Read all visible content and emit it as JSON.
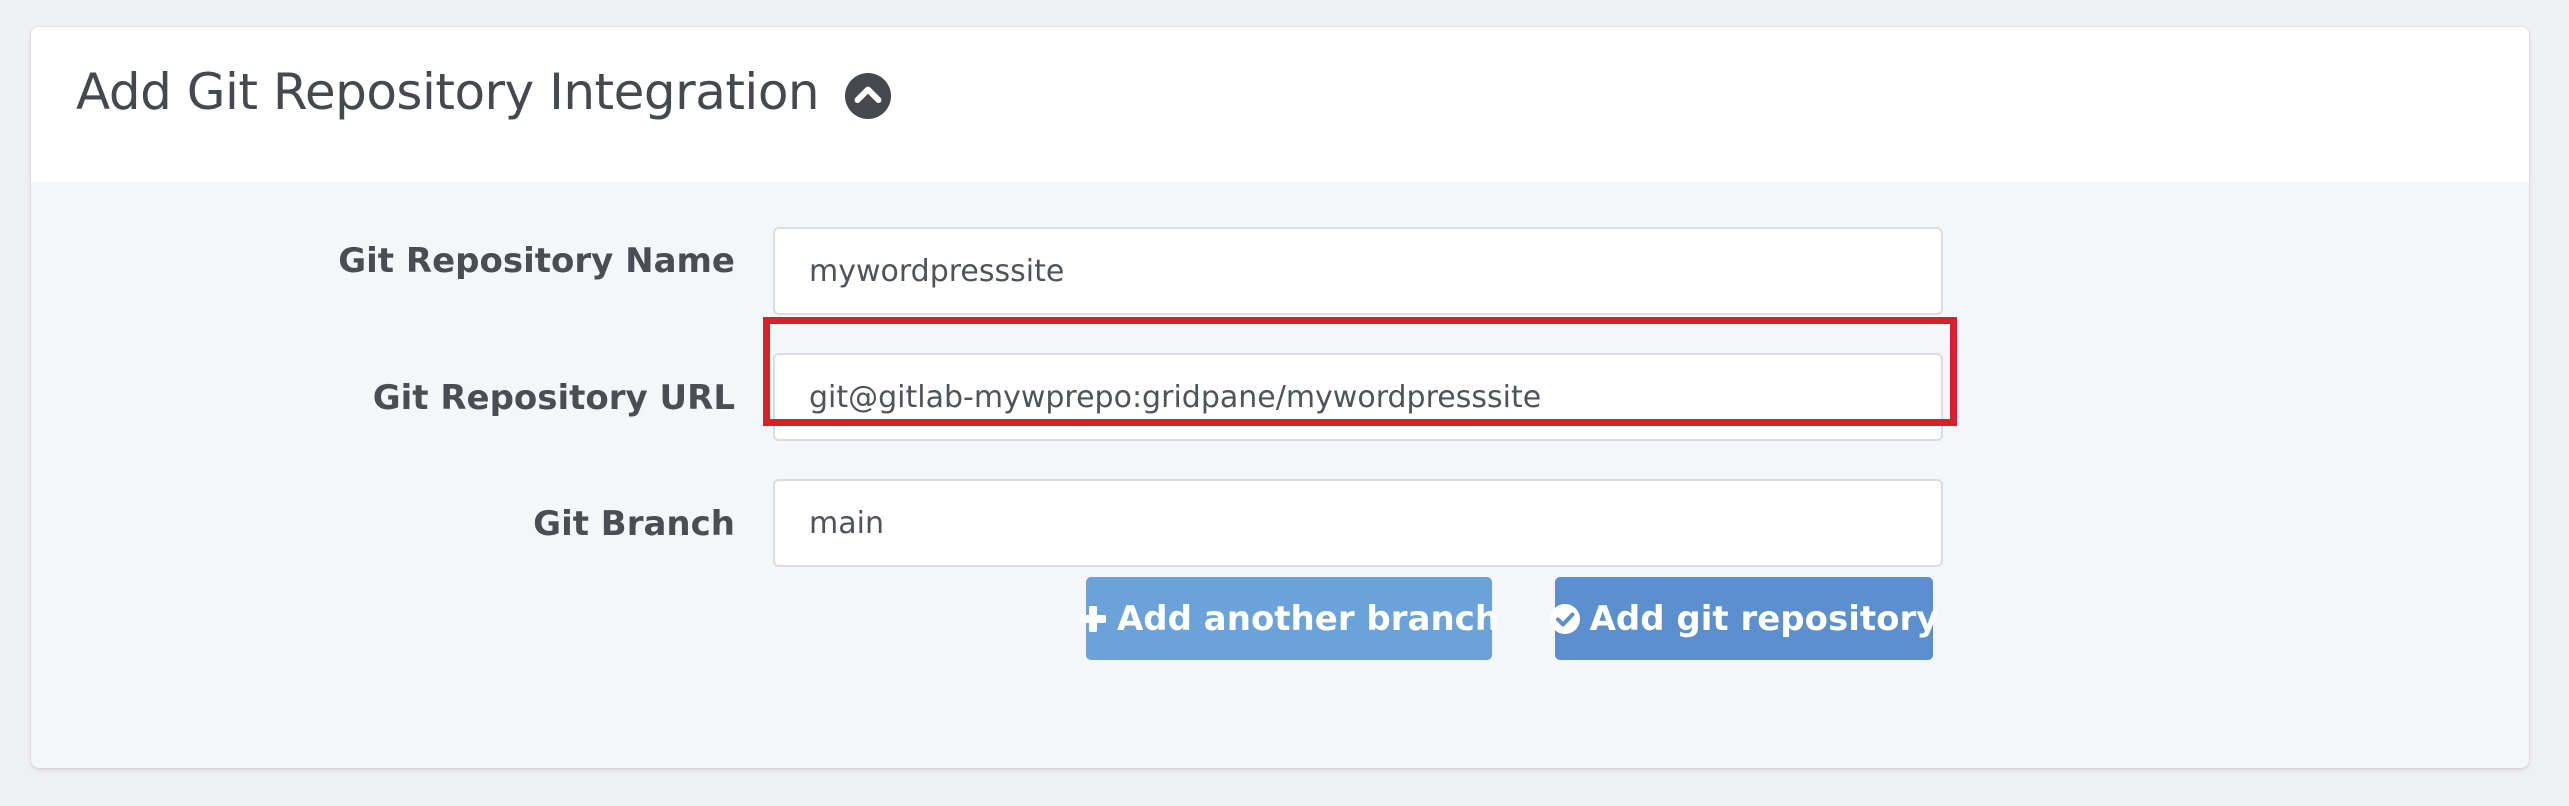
{
  "header": {
    "title": "Add Git Repository Integration",
    "toggle_icon": "chevron-circle-up-icon"
  },
  "form": {
    "repo_name": {
      "label": "Git Repository Name",
      "value": "mywordpresssite"
    },
    "repo_url": {
      "label": "Git Repository URL",
      "value": "git@gitlab-mywprepo:gridpane/mywordpresssite",
      "highlighted": true
    },
    "branch": {
      "label": "Git Branch",
      "value": "main"
    }
  },
  "actions": {
    "add_branch": {
      "label": "Add another branch",
      "icon": "plus-icon"
    },
    "add_repo": {
      "label": "Add git repository",
      "icon": "check-circle-icon"
    }
  },
  "colors": {
    "highlight": "#d81f2b",
    "button_light": "#6ba2da",
    "button_primary": "#5b8fce",
    "title_text": "#45494f"
  }
}
